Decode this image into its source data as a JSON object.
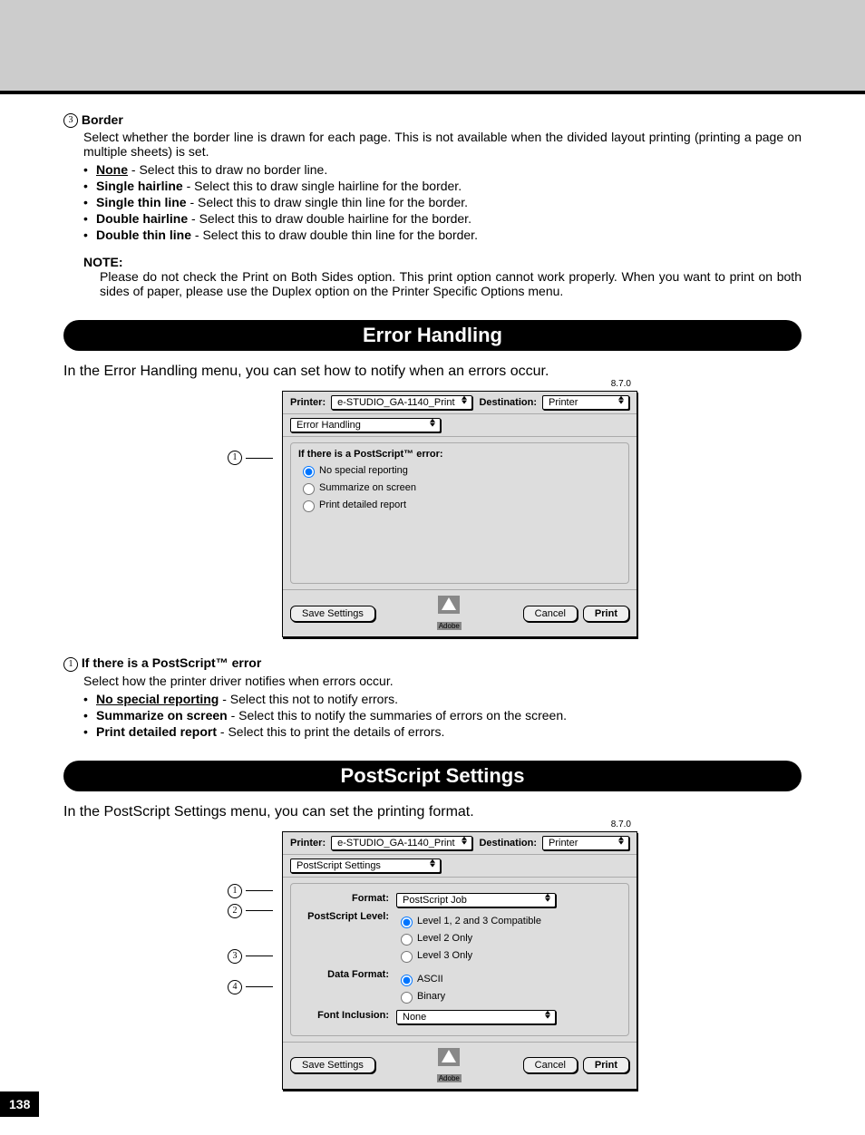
{
  "page_number": "138",
  "border": {
    "num": "3",
    "title": "Border",
    "desc": "Select whether the border line is drawn for each page.  This is not available when the divided layout printing (printing a page on multiple sheets) is set.",
    "items": [
      {
        "name": "None",
        "rest": " - Select this to draw no border line.",
        "underline": true
      },
      {
        "name": "Single hairline",
        "rest": " - Select this to draw single hairline for the border.",
        "underline": false
      },
      {
        "name": "Single thin line",
        "rest": " - Select this to draw single thin line for the border.",
        "underline": false
      },
      {
        "name": "Double hairline",
        "rest": " - Select this to draw double hairline for the border.",
        "underline": false
      },
      {
        "name": "Double thin line",
        "rest": " - Select this to draw double thin line for the border.",
        "underline": false
      }
    ],
    "note_label": "NOTE:",
    "note_body": "Please do not check the Print on Both Sides option.  This print option cannot work properly.  When you want to print on both sides of paper, please use the Duplex option on the Printer Specific Options menu."
  },
  "error_section": {
    "banner": "Error Handling",
    "intro": "In the Error Handling menu, you can set how to notify when an errors occur.",
    "dialog": {
      "version": "8.7.0",
      "printer_label": "Printer:",
      "printer_value": "e-STUDIO_GA-1140_Print",
      "dest_label": "Destination:",
      "dest_value": "Printer",
      "menu_value": "Error Handling",
      "group_label": "If there is a PostScript™ error:",
      "radios": [
        "No special reporting",
        "Summarize on screen",
        "Print detailed report"
      ],
      "save": "Save Settings",
      "cancel": "Cancel",
      "print": "Print",
      "adobe": "Adobe"
    },
    "item": {
      "num": "1",
      "title": "If there is a PostScript™ error",
      "desc": "Select how the printer driver notifies when errors occur.",
      "bullets": [
        {
          "name": "No special reporting",
          "rest": " - Select this not to notify errors.",
          "underline": true
        },
        {
          "name": "Summarize on screen",
          "rest": " - Select this to notify the summaries of errors on the screen.",
          "underline": false
        },
        {
          "name": "Print detailed report",
          "rest": " - Select this to print the details of errors.",
          "underline": false
        }
      ]
    }
  },
  "ps_section": {
    "banner": "PostScript Settings",
    "intro": "In the PostScript Settings menu, you can set the printing format.",
    "dialog": {
      "version": "8.7.0",
      "printer_label": "Printer:",
      "printer_value": "e-STUDIO_GA-1140_Print",
      "dest_label": "Destination:",
      "dest_value": "Printer",
      "menu_value": "PostScript Settings",
      "format_label": "Format:",
      "format_value": "PostScript Job",
      "level_label": "PostScript Level:",
      "level_radios": [
        "Level 1, 2 and 3 Compatible",
        "Level 2 Only",
        "Level 3 Only"
      ],
      "dataf_label": "Data Format:",
      "dataf_radios": [
        "ASCII",
        "Binary"
      ],
      "fontinc_label": "Font Inclusion:",
      "fontinc_value": "None",
      "save": "Save Settings",
      "cancel": "Cancel",
      "print": "Print",
      "adobe": "Adobe"
    },
    "callouts": [
      "1",
      "2",
      "3",
      "4"
    ]
  }
}
